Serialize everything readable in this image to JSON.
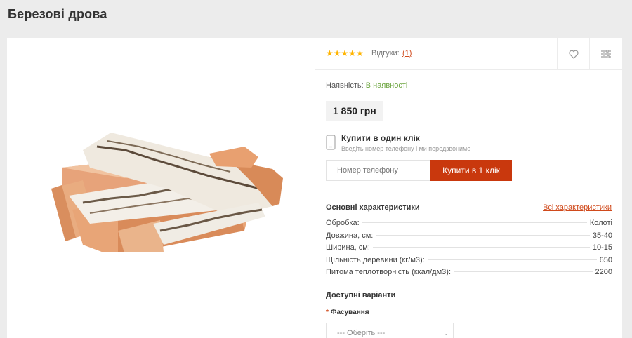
{
  "page": {
    "title": "Березові дрова"
  },
  "product": {
    "rating": {
      "stars": 5,
      "stars_text": "★★★★★",
      "reviews_label": "Відгуки:",
      "reviews_count": "(1)"
    },
    "availability": {
      "label": "Наявність:",
      "value": "В наявності"
    },
    "price": "1 850 грн",
    "one_click": {
      "title": "Купити в один клік",
      "subtitle": "Введіть номер телефону і ми передзвонимо",
      "phone_placeholder": "Номер телефону",
      "button_label": "Купити в 1 клік"
    },
    "specs": {
      "title": "Основні характеристики",
      "all_link": "Всі характеристики",
      "rows": [
        {
          "key": "Обробка:",
          "value": "Колоті"
        },
        {
          "key": "Довжина, см:",
          "value": "35-40"
        },
        {
          "key": "Ширина, см:",
          "value": "10-15"
        },
        {
          "key": "Щільність деревини (кг/м3):",
          "value": "650"
        },
        {
          "key": "Питома теплотворність (ккал/дм3):",
          "value": "2200"
        }
      ]
    },
    "variants": {
      "title": "Доступні варіанти",
      "required_mark": "*",
      "packaging_label": "Фасування",
      "packaging_selected": "--- Оберіть ---"
    }
  },
  "icons": {
    "wishlist": "heart-icon",
    "compare": "compare-icon",
    "phone": "phone-icon"
  },
  "colors": {
    "accent": "#c9380d",
    "link": "#d04a1c",
    "in_stock": "#6aa33c",
    "stars": "#ffb400"
  }
}
